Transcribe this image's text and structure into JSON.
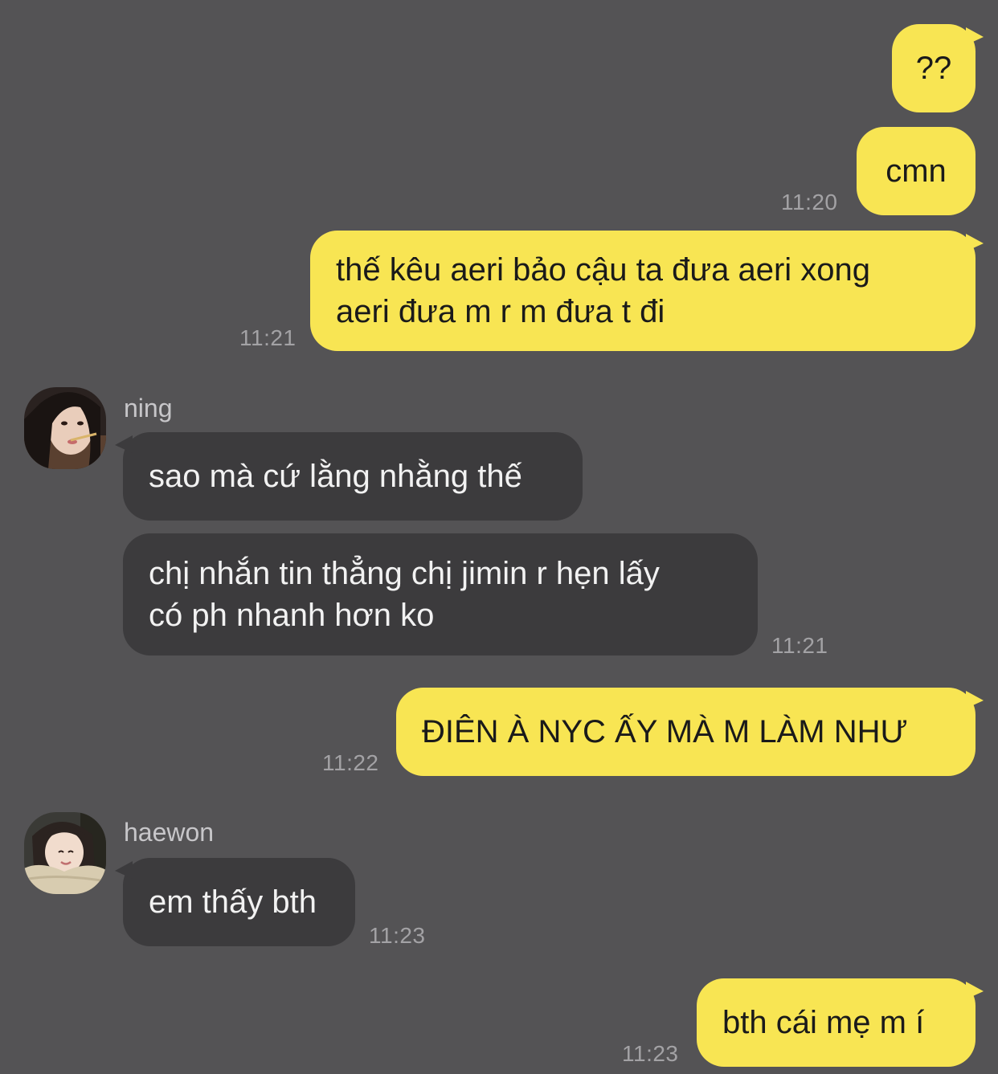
{
  "messages": [
    {
      "direction": "outgoing",
      "text": "??",
      "time": ""
    },
    {
      "direction": "outgoing",
      "text": "cmn",
      "time": "11:20"
    },
    {
      "direction": "outgoing",
      "text": "thế kêu aeri bảo cậu ta đưa aeri xong\naeri đưa m r m đưa t đi",
      "time": "11:21"
    },
    {
      "direction": "incoming",
      "sender": "ning",
      "text": "sao mà cứ lằng nhằng thế",
      "time": ""
    },
    {
      "direction": "incoming",
      "sender": "ning",
      "text": "chị nhắn tin thẳng chị jimin r hẹn lấy\ncó ph nhanh hơn ko",
      "time": "11:21"
    },
    {
      "direction": "outgoing",
      "text": "ĐIÊN À NYC ẤY MÀ M LÀM NHƯ",
      "time": "11:22"
    },
    {
      "direction": "incoming",
      "sender": "haewon",
      "text": "em thấy bth",
      "time": "11:23"
    },
    {
      "direction": "outgoing",
      "text": "bth cái mẹ m í",
      "time": "11:23"
    }
  ],
  "senders": {
    "ning": {
      "name": "ning",
      "avatar_icon": "profile-photo-ning"
    },
    "haewon": {
      "name": "haewon",
      "avatar_icon": "profile-photo-haewon"
    }
  },
  "colors": {
    "background": "#545355",
    "outgoing_bubble": "#f8e553",
    "incoming_bubble": "#3c3b3d",
    "timestamp": "#a3a2a5"
  }
}
